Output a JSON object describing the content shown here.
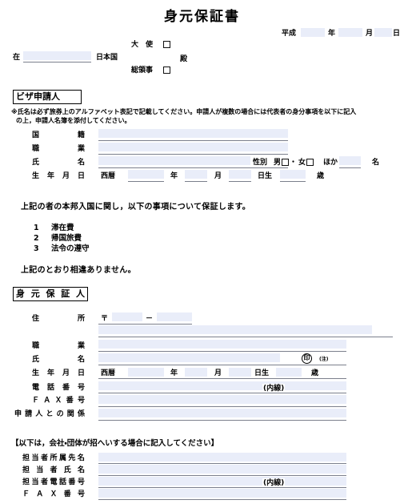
{
  "document": {
    "title": "身元保証書"
  },
  "header": {
    "era": "平成",
    "year_unit": "年",
    "month_unit": "月",
    "day_unit": "日",
    "year_value": "",
    "month_value": "",
    "day_value": "",
    "at_label": "在",
    "at_value": "",
    "country_label": "日本国",
    "ambassador_label": "大　使",
    "consul_label": "総領事",
    "honorific": "殿"
  },
  "applicant": {
    "section_title": "ビザ申請人",
    "note_line1": "※氏名は必ず旅券上のアルファベット表記で記載してください。申請人が複数の場合には代表者の身分事項を以下に記入",
    "note_line2": "の上，申請人名簿を添付してください。",
    "nationality_label": "国籍",
    "nationality_value": "",
    "occupation_label": "職業",
    "occupation_value": "",
    "name_label": "氏名",
    "name_value": "",
    "gender_label": "性別",
    "gender_male": "男",
    "gender_separator": "・",
    "gender_female": "女",
    "others_label": "ほか",
    "others_value": "",
    "others_unit": "名",
    "birth_label": "生年月日",
    "calendar_label": "西暦",
    "birth_year": "",
    "birth_year_unit": "年",
    "birth_month": "",
    "birth_month_unit": "月",
    "birth_day": "",
    "birth_day_unit": "日生",
    "age_value": "",
    "age_unit": "歳"
  },
  "guarantee": {
    "intro": "上記の者の本邦入国に関し，以下の事項について保証します。",
    "items": [
      {
        "no": "1",
        "text": "滞在費"
      },
      {
        "no": "2",
        "text": "帰国旅費"
      },
      {
        "no": "3",
        "text": "法令の遵守"
      }
    ],
    "closing": "上記のとおり相違ありません。"
  },
  "guarantor": {
    "section_title": "身元保証人",
    "address_label": "住所",
    "postal_mark": "〒",
    "postal_first": "",
    "postal_dash": "－",
    "postal_second": "",
    "address_value": "",
    "occupation_label": "職業",
    "occupation_value": "",
    "name_label": "氏名",
    "name_value": "",
    "seal_glyph": "印",
    "seal_note": "(注)",
    "birth_label": "生年月日",
    "calendar_label": "西暦",
    "birth_year": "",
    "birth_year_unit": "年",
    "birth_month": "",
    "birth_month_unit": "月",
    "birth_day": "",
    "birth_day_unit": "日生",
    "age_value": "",
    "age_unit": "歳",
    "tel_label": "電話番号",
    "tel_value": "",
    "tel_ext_label": "(内線)",
    "tel_ext_value": "",
    "fax_label": "ＦＡＸ番号",
    "fax_value": "",
    "relation_label": "申請人との関係",
    "relation_value": ""
  },
  "company": {
    "section_note": "【以下は，会社・団体が招へいする場合に記入してください】",
    "affiliation_label": "担当者所属先名",
    "affiliation_value": "",
    "contact_name_label": "担当者氏名",
    "contact_name_value": "",
    "contact_tel_label": "担当者電話番号",
    "contact_tel_value": "",
    "contact_tel_ext_label": "(内線)",
    "contact_tel_ext_value": "",
    "contact_fax_label": "ＦＡＸ番号",
    "contact_fax_value": ""
  }
}
